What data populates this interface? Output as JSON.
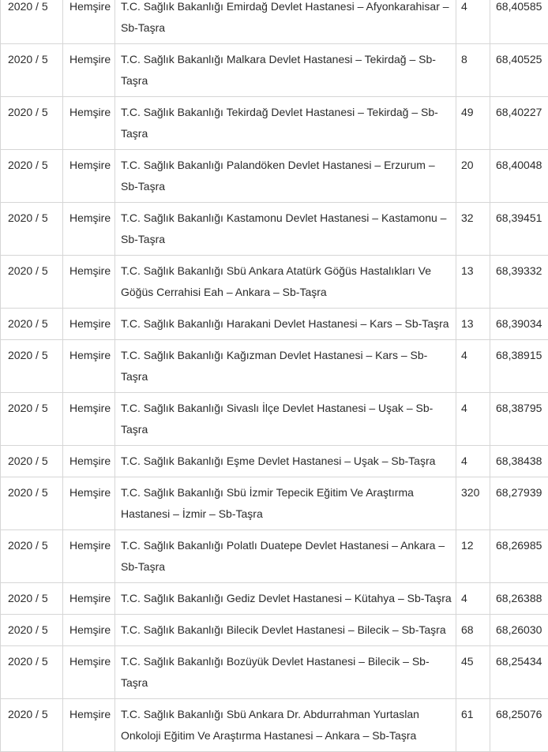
{
  "rows": [
    {
      "period": "2020 / 5",
      "title": "Hemşire",
      "institution": "T.C. Sağlık Bakanlığı Emirdağ Devlet Hastanesi – Afyonkarahisar – Sb-Taşra",
      "quota": "4",
      "score": "68,40585"
    },
    {
      "period": "2020 / 5",
      "title": "Hemşire",
      "institution": "T.C. Sağlık Bakanlığı Malkara Devlet Hastanesi – Tekirdağ – Sb-Taşra",
      "quota": "8",
      "score": "68,40525"
    },
    {
      "period": "2020 / 5",
      "title": "Hemşire",
      "institution": "T.C. Sağlık Bakanlığı Tekirdağ Devlet Hastanesi – Tekirdağ – Sb-Taşra",
      "quota": "49",
      "score": "68,40227"
    },
    {
      "period": "2020 / 5",
      "title": "Hemşire",
      "institution": "T.C. Sağlık Bakanlığı Palandöken Devlet Hastanesi – Erzurum – Sb-Taşra",
      "quota": "20",
      "score": "68,40048"
    },
    {
      "period": "2020 / 5",
      "title": "Hemşire",
      "institution": "T.C. Sağlık Bakanlığı Kastamonu Devlet Hastanesi – Kastamonu – Sb-Taşra",
      "quota": "32",
      "score": "68,39451"
    },
    {
      "period": "2020 / 5",
      "title": "Hemşire",
      "institution": "T.C. Sağlık Bakanlığı Sbü Ankara Atatürk Göğüs Hastalıkları Ve Göğüs Cerrahisi Eah – Ankara – Sb-Taşra",
      "quota": "13",
      "score": "68,39332"
    },
    {
      "period": "2020 / 5",
      "title": "Hemşire",
      "institution": "T.C. Sağlık Bakanlığı Harakani Devlet Hastanesi – Kars – Sb-Taşra",
      "quota": "13",
      "score": "68,39034"
    },
    {
      "period": "2020 / 5",
      "title": "Hemşire",
      "institution": "T.C. Sağlık Bakanlığı Kağızman Devlet Hastanesi – Kars – Sb-Taşra",
      "quota": "4",
      "score": "68,38915"
    },
    {
      "period": "2020 / 5",
      "title": "Hemşire",
      "institution": "T.C. Sağlık Bakanlığı Sivaslı İlçe Devlet Hastanesi – Uşak – Sb-Taşra",
      "quota": "4",
      "score": "68,38795"
    },
    {
      "period": "2020 / 5",
      "title": "Hemşire",
      "institution": "T.C. Sağlık Bakanlığı Eşme Devlet Hastanesi – Uşak – Sb-Taşra",
      "quota": "4",
      "score": "68,38438"
    },
    {
      "period": "2020 / 5",
      "title": "Hemşire",
      "institution": "T.C. Sağlık Bakanlığı Sbü İzmir Tepecik Eğitim Ve Araştırma Hastanesi – İzmir – Sb-Taşra",
      "quota": "320",
      "score": "68,27939"
    },
    {
      "period": "2020 / 5",
      "title": "Hemşire",
      "institution": "T.C. Sağlık Bakanlığı Polatlı Duatepe Devlet Hastanesi – Ankara – Sb-Taşra",
      "quota": "12",
      "score": "68,26985"
    },
    {
      "period": "2020 / 5",
      "title": "Hemşire",
      "institution": "T.C. Sağlık Bakanlığı Gediz Devlet Hastanesi – Kütahya – Sb-Taşra",
      "quota": "4",
      "score": "68,26388"
    },
    {
      "period": "2020 / 5",
      "title": "Hemşire",
      "institution": "T.C. Sağlık Bakanlığı Bilecik Devlet Hastanesi – Bilecik – Sb-Taşra",
      "quota": "68",
      "score": "68,26030"
    },
    {
      "period": "2020 / 5",
      "title": "Hemşire",
      "institution": "T.C. Sağlık Bakanlığı Bozüyük Devlet Hastanesi – Bilecik – Sb-Taşra",
      "quota": "45",
      "score": "68,25434"
    },
    {
      "period": "2020 / 5",
      "title": "Hemşire",
      "institution": "T.C. Sağlık Bakanlığı Sbü Ankara Dr. Abdurrahman Yurtaslan Onkoloji Eğitim Ve Araştırma Hastanesi – Ankara – Sb-Taşra",
      "quota": "61",
      "score": "68,25076"
    }
  ]
}
